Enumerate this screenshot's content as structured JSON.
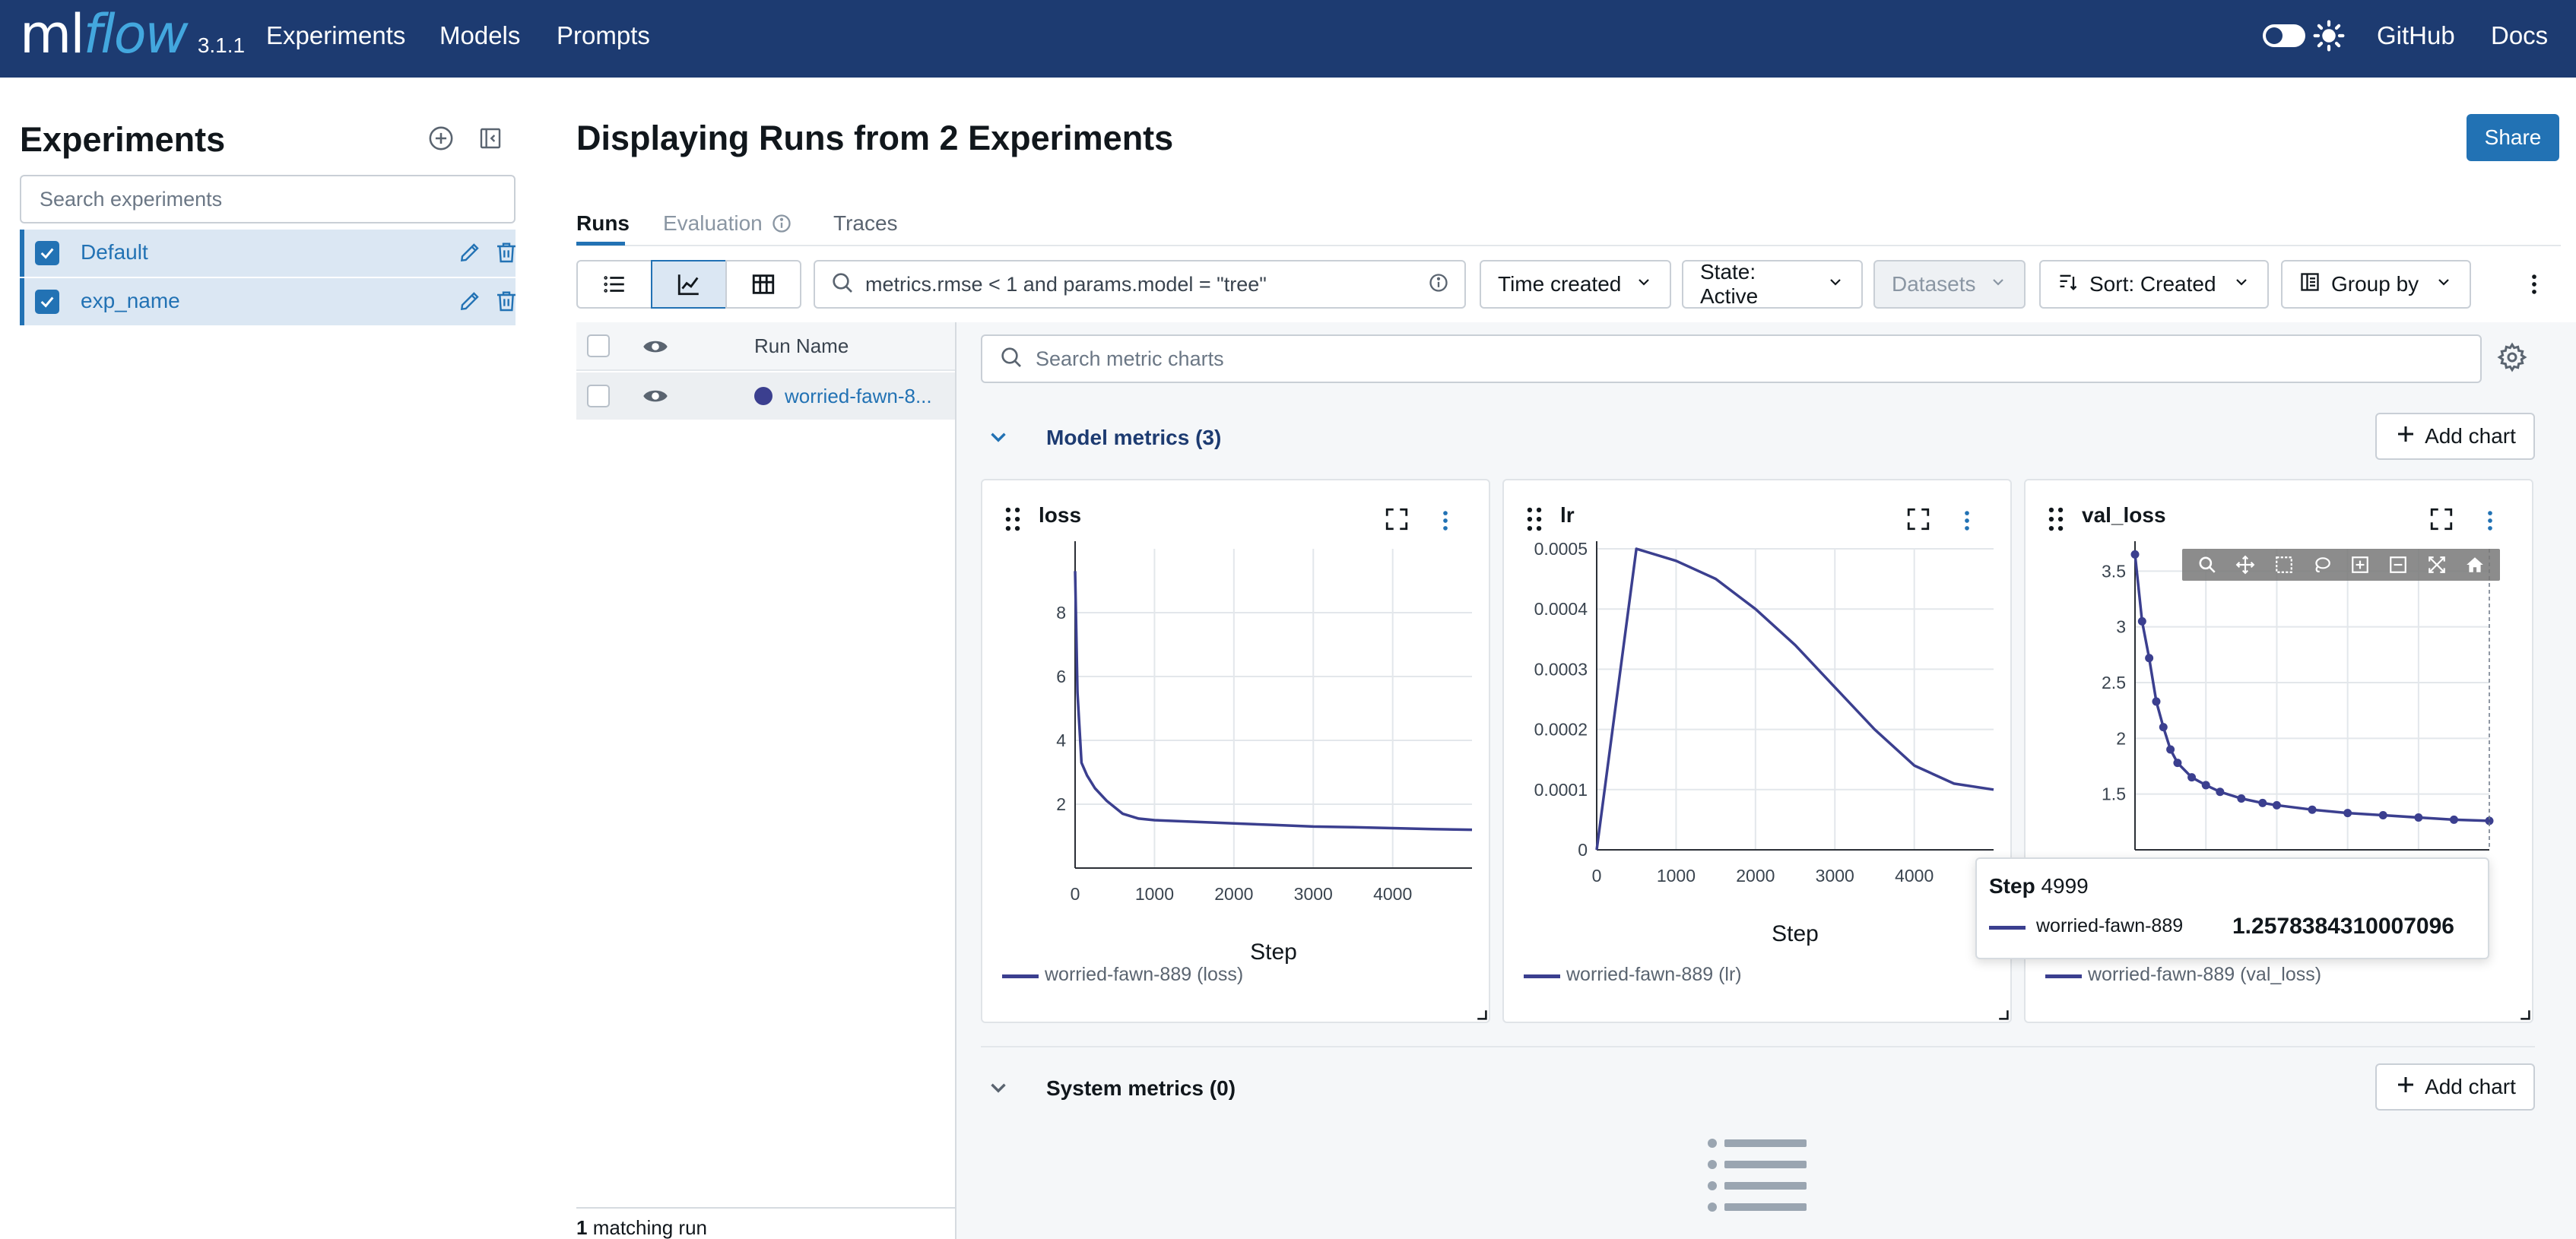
{
  "nav": {
    "logo_prefix": "ml",
    "logo_suffix": "flow",
    "version": "3.1.1",
    "links": [
      "Experiments",
      "Models",
      "Prompts"
    ],
    "github": "GitHub",
    "docs": "Docs"
  },
  "sidebar": {
    "title": "Experiments",
    "search_placeholder": "Search experiments",
    "experiments": [
      {
        "name": "Default",
        "checked": true
      },
      {
        "name": "exp_name",
        "checked": true
      }
    ]
  },
  "main": {
    "title": "Displaying Runs from 2 Experiments",
    "share_label": "Share",
    "tabs": [
      "Runs",
      "Evaluation",
      "Traces"
    ],
    "filter_value": "metrics.rmse < 1 and params.model = \"tree\"",
    "dropdowns": {
      "time": "Time created",
      "state": "State: Active",
      "datasets": "Datasets",
      "sort": "Sort: Created",
      "group": "Group by"
    }
  },
  "runs_table": {
    "column_run_name": "Run Name",
    "rows": [
      {
        "name": "worried-fawn-8...",
        "color": "#3b3f8f"
      }
    ],
    "footer_count": "1",
    "footer_text": "matching run"
  },
  "charts_panel": {
    "search_placeholder": "Search metric charts",
    "model_section": {
      "title": "Model metrics",
      "count": "(3)"
    },
    "system_section": {
      "title": "System metrics",
      "count": "(0)"
    },
    "add_chart_label": "Add chart",
    "series_color": "#3b3f8f"
  },
  "chart_data": [
    {
      "type": "line",
      "title": "loss",
      "xlabel": "Step",
      "ylabel": "",
      "xlim": [
        0,
        4999
      ],
      "ylim": [
        0,
        10
      ],
      "xticks": [
        0,
        1000,
        2000,
        3000,
        4000
      ],
      "yticks": [
        2,
        4,
        6,
        8
      ],
      "legend": "worried-fawn-889 (loss)",
      "series": [
        {
          "name": "worried-fawn-889 (loss)",
          "x": [
            0,
            30,
            80,
            150,
            250,
            400,
            600,
            800,
            1000,
            1500,
            2000,
            2500,
            3000,
            3500,
            4000,
            4500,
            4999
          ],
          "y": [
            9.3,
            5.5,
            3.3,
            2.9,
            2.5,
            2.1,
            1.7,
            1.55,
            1.5,
            1.45,
            1.4,
            1.35,
            1.3,
            1.28,
            1.25,
            1.22,
            1.2
          ]
        }
      ]
    },
    {
      "type": "line",
      "title": "lr",
      "xlabel": "Step",
      "ylabel": "",
      "xlim": [
        0,
        4999
      ],
      "ylim": [
        0,
        0.0005
      ],
      "xticks": [
        0,
        1000,
        2000,
        3000,
        4000
      ],
      "yticks": [
        0,
        0.0001,
        0.0002,
        0.0003,
        0.0004,
        0.0005
      ],
      "legend": "worried-fawn-889 (lr)",
      "series": [
        {
          "name": "worried-fawn-889 (lr)",
          "x": [
            0,
            500,
            1000,
            1500,
            2000,
            2500,
            3000,
            3500,
            4000,
            4500,
            4999
          ],
          "y": [
            0,
            0.0005,
            0.00048,
            0.00045,
            0.0004,
            0.00034,
            0.00027,
            0.0002,
            0.00014,
            0.00011,
            0.0001
          ]
        }
      ]
    },
    {
      "type": "line",
      "title": "val_loss",
      "xlabel": "",
      "ylabel": "",
      "xlim": [
        0,
        4999
      ],
      "ylim": [
        1.0,
        3.7
      ],
      "yticks": [
        1.5,
        2,
        2.5,
        3,
        3.5
      ],
      "legend": "worried-fawn-889 (val_loss)",
      "series": [
        {
          "name": "worried-fawn-889 (val_loss)",
          "x": [
            0,
            100,
            200,
            300,
            400,
            500,
            600,
            800,
            1000,
            1200,
            1500,
            1800,
            2000,
            2500,
            3000,
            3500,
            4000,
            4500,
            4999
          ],
          "y": [
            3.65,
            3.05,
            2.72,
            2.33,
            2.1,
            1.9,
            1.78,
            1.65,
            1.58,
            1.52,
            1.46,
            1.42,
            1.4,
            1.36,
            1.33,
            1.31,
            1.29,
            1.27,
            1.26
          ]
        }
      ],
      "tooltip": {
        "step_label": "Step",
        "step": "4999",
        "run": "worried-fawn-889",
        "value": "1.2578384310007096"
      }
    }
  ]
}
